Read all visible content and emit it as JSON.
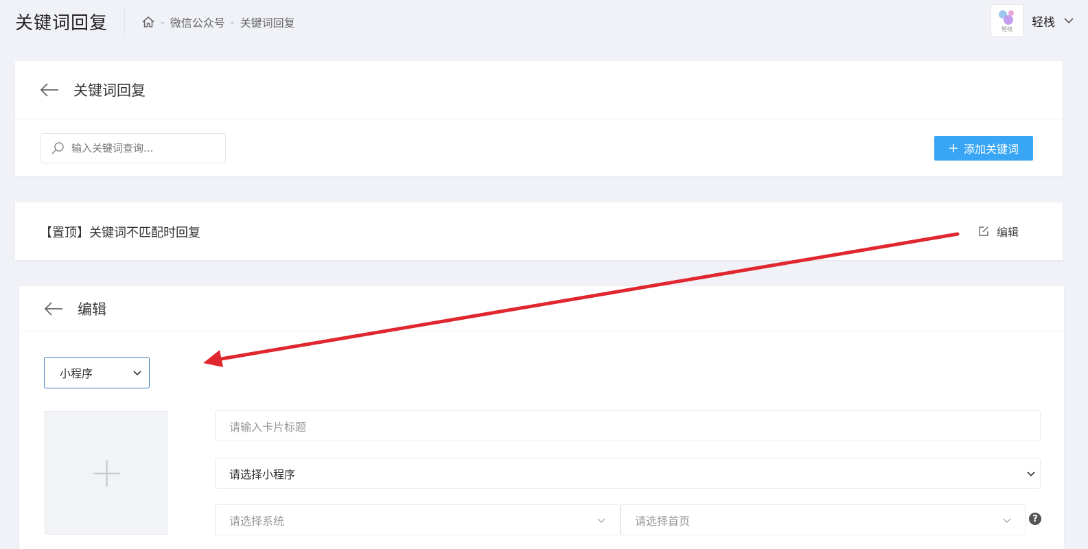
{
  "header": {
    "title": "关键词回复",
    "breadcrumb": [
      "微信公众号",
      "关键词回复"
    ],
    "breadcrumb_sep": "-",
    "user_name": "轻栈",
    "avatar_text": "轻栈"
  },
  "list_card": {
    "title": "关键词回复",
    "search_placeholder": "输入关键词查询...",
    "add_button": "添加关键词"
  },
  "pinned": {
    "label": "【置顶】关键词不匹配时回复",
    "edit_label": "编辑"
  },
  "edit_card": {
    "title": "编辑",
    "reply_type": "小程序",
    "card_title_placeholder": "请输入卡片标题",
    "miniprogram_select": "请选择小程序",
    "system_select": "请选择系统",
    "homepage_select": "请选择首页",
    "help": "?"
  },
  "colors": {
    "primary": "#38a6f4",
    "select_border": "#3d7bb8",
    "annotation_arrow": "#e0262e"
  },
  "icons": [
    "home-icon",
    "back-arrow-icon",
    "search-icon",
    "plus-icon",
    "edit-icon",
    "chevron-down-icon",
    "question-icon"
  ]
}
